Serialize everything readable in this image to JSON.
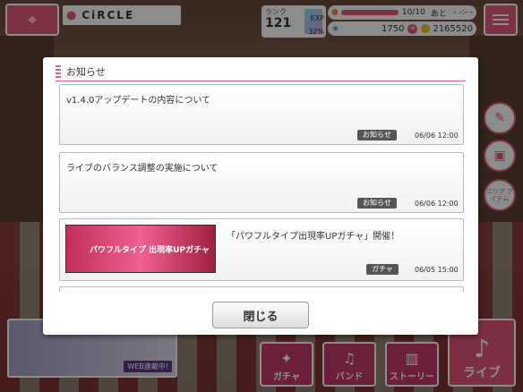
{
  "header": {
    "location": "CiRCLE",
    "rank_label": "ランク",
    "rank_value": "121",
    "exp_label": "EXP",
    "exp_percent": "32%",
    "stamina": "10/10",
    "stamina_suffix": "あと",
    "stamina_timer": "- -:- -",
    "stars": "1750",
    "coins": "2165520"
  },
  "side_buttons": {
    "area_item": "エリア アイテム"
  },
  "modal": {
    "title": "お知らせ",
    "items": [
      {
        "text": "v1.4.0アップデートの内容について",
        "tag": "お知らせ",
        "date": "06/06 12:00"
      },
      {
        "text": "ライブのバランス調整の実施について",
        "tag": "お知らせ",
        "date": "06/06 12:00"
      },
      {
        "text": "「パワフルタイプ出現率UPガチャ」開催！",
        "tag": "ガチャ",
        "date": "06/05 15:00",
        "banner": "パワフルタイプ 出現率UPガチャ"
      }
    ],
    "close_label": "閉じる"
  },
  "bottom_nav": {
    "banner_text": "WEB連載中!",
    "gacha": "ガチャ",
    "band": "バンド",
    "story": "ストーリー",
    "live": "ライブ"
  },
  "colors": {
    "accent": "#e45a7a",
    "tag": "#555555"
  }
}
